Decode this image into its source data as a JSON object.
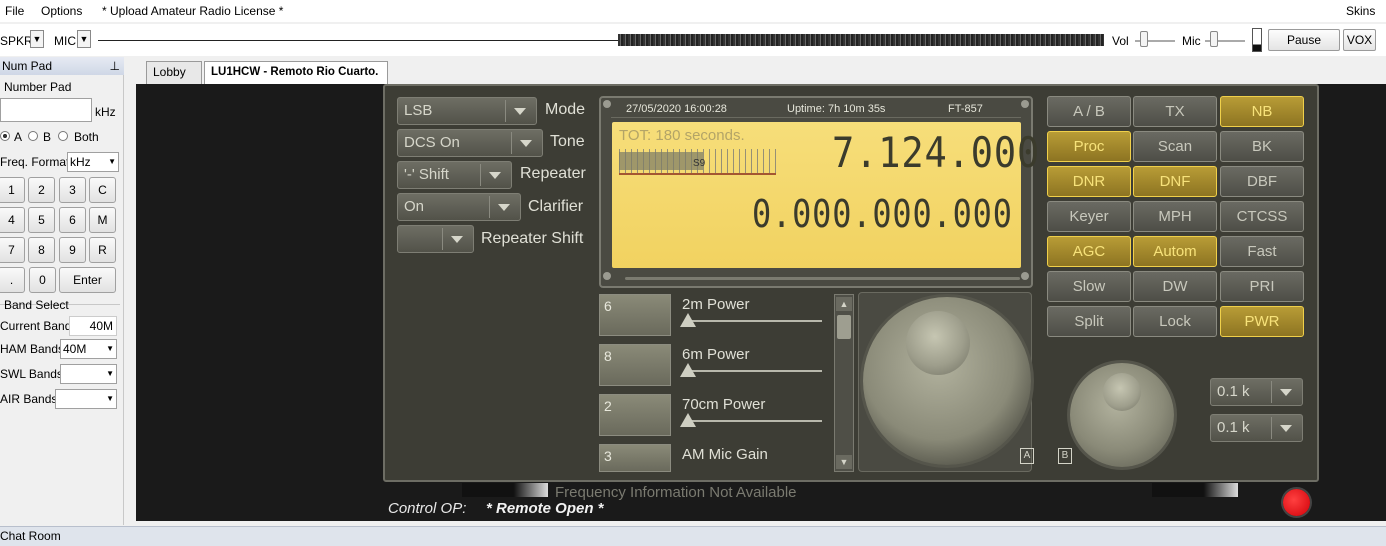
{
  "menu": {
    "file": "File",
    "options": "Options",
    "upload": "* Upload Amateur Radio License *",
    "skins": "Skins"
  },
  "toolbar": {
    "spkr": "SPKR",
    "mic": "MIC",
    "vol": "Vol",
    "mic2": "Mic",
    "pause": "Pause",
    "vox": "VOX"
  },
  "numpad": {
    "header": "Num Pad",
    "pin_icon": "pin-icon",
    "group": "Number Pad",
    "input_value": "",
    "unit": "kHz",
    "radio_a": "A",
    "radio_b": "B",
    "radio_both": "Both",
    "radio_selected": "A",
    "freq_format_label": "Freq. Format",
    "freq_format_value": "kHz",
    "keys": [
      "1",
      "2",
      "3",
      "C",
      "4",
      "5",
      "6",
      "M",
      "7",
      "8",
      "9",
      "R",
      ".",
      "0",
      "Enter"
    ]
  },
  "band": {
    "group": "Band Select",
    "current_label": "Current Band",
    "current_value": "40M",
    "ham_label": "HAM Bands",
    "ham_value": "40M",
    "swl_label": "SWL Bands",
    "swl_value": "",
    "air_label": "AIR Bands",
    "air_value": ""
  },
  "tabs": {
    "lobby": "Lobby",
    "active": "LU1HCW - Remoto Rio Cuarto."
  },
  "rig": {
    "mode_value": "LSB",
    "mode_label": "Mode",
    "tone_value": "DCS On",
    "tone_label": "Tone",
    "repeater_value": "'-' Shift",
    "repeater_label": "Repeater",
    "clarifier_value": "On",
    "clarifier_label": "Clarifier",
    "repeater_shift_value": "",
    "repeater_shift_label": "Repeater Shift",
    "lcd": {
      "date": "27/05/2020 16:00:28",
      "uptime": "Uptime: 7h 10m 35s",
      "model": "FT-857",
      "tot": "TOT: 180 seconds.",
      "meter_value": "S9",
      "freq_a": "7.124.000",
      "freq_b": "0.000.000.000"
    },
    "memories": [
      {
        "num": "6",
        "label": "2m Power",
        "level": 0.0
      },
      {
        "num": "8",
        "label": "6m Power",
        "level": 0.0
      },
      {
        "num": "2",
        "label": "70cm Power",
        "level": 0.0
      },
      {
        "num": "3",
        "label": "AM Mic Gain",
        "level": 0.0
      }
    ],
    "buttons": [
      {
        "label": "A / B",
        "on": false
      },
      {
        "label": "TX",
        "on": false
      },
      {
        "label": "NB",
        "on": true
      },
      {
        "label": "Proc",
        "on": true
      },
      {
        "label": "Scan",
        "on": false
      },
      {
        "label": "BK",
        "on": false
      },
      {
        "label": "DNR",
        "on": true
      },
      {
        "label": "DNF",
        "on": true
      },
      {
        "label": "DBF",
        "on": false
      },
      {
        "label": "Keyer",
        "on": false
      },
      {
        "label": "MPH",
        "on": false
      },
      {
        "label": "CTCSS",
        "on": false
      },
      {
        "label": "AGC",
        "on": true
      },
      {
        "label": "Autom",
        "on": true
      },
      {
        "label": "Fast",
        "on": false
      },
      {
        "label": "Slow",
        "on": false
      },
      {
        "label": "DW",
        "on": false
      },
      {
        "label": "PRI",
        "on": false
      },
      {
        "label": "Split",
        "on": false
      },
      {
        "label": "Lock",
        "on": false
      },
      {
        "label": "PWR",
        "on": true
      }
    ],
    "step1": "0.1 k",
    "step2": "0.1 k",
    "knob_a": "A",
    "knob_b": "B",
    "freq_info": "Frequency Information Not Available",
    "control_op_label": "Control OP:",
    "control_op_value": "* Remote Open *"
  },
  "status": {
    "chat": "Chat Room"
  },
  "colors": {
    "lcd": "#f4d86a",
    "button_on": "#a88e2e",
    "panel": "#3d3d35",
    "record": "#e0000a"
  }
}
